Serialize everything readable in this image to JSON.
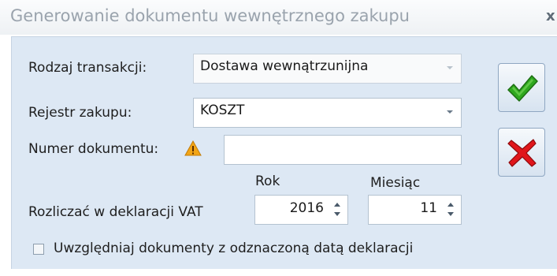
{
  "window": {
    "title": "Generowanie dokumentu wewnętrznego zakupu",
    "close_label": "x"
  },
  "form": {
    "transaction_type": {
      "label": "Rodzaj transakcji:",
      "value": "Dostawa wewnątrzunijna"
    },
    "purchase_register": {
      "label": "Rejestr zakupu:",
      "value": "KOSZT"
    },
    "document_number": {
      "label": "Numer dokumentu:",
      "value": ""
    },
    "vat_declaration": {
      "label": "Rozliczać w deklaracji VAT",
      "year_header": "Rok",
      "month_header": "Miesiąc",
      "year": "2016",
      "month": "11"
    },
    "include_checkbox": {
      "label": "Uwzględniaj dokumenty z odznaczoną datą deklaracji",
      "checked": false
    }
  },
  "actions": {
    "confirm_icon": "green-checkmark-icon",
    "cancel_icon": "red-cross-icon"
  },
  "colors": {
    "panel_bg": "#dde8f4",
    "confirm": "#2fa81f",
    "cancel": "#e0161b",
    "warning": "#f2a516"
  }
}
